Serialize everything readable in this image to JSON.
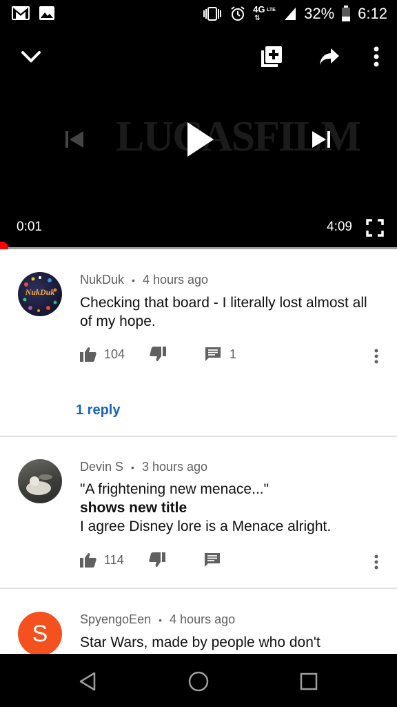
{
  "status_bar": {
    "network": "4G",
    "lte": "LTE",
    "battery": "32%",
    "time": "6:12"
  },
  "player": {
    "logo_text": "LUCASFILM",
    "current_time": "0:01",
    "duration": "4:09",
    "progress_fraction": 0.004,
    "icons": [
      "collapse-chevron-icon",
      "add-to-playlist-icon",
      "share-icon",
      "more-vert-icon",
      "skip-previous-icon",
      "play-icon",
      "skip-next-icon",
      "fullscreen-icon"
    ]
  },
  "comments": [
    {
      "author": "NukDuk",
      "age": "4 hours ago",
      "separator": "•",
      "text": "Checking that board - I literally lost almost all of my hope.",
      "likes": "104",
      "replies_count": "1",
      "reply_link": "1 reply",
      "avatar_text": "NukDuk",
      "avatar_color": "#1a1a2e"
    },
    {
      "author": "Devin S",
      "age": "3 hours ago",
      "separator": "•",
      "text_line1": "\"A frightening new menace...\"",
      "text_bold": "shows new title",
      "text_line3": "I agree Disney lore is a Menace alright.",
      "likes": "114",
      "avatar_color": "#5a5a55"
    },
    {
      "author": "SpyengoEen",
      "age": "4 hours ago",
      "separator": "•",
      "text": "Star Wars, made by people who don't",
      "avatar_letter": "S",
      "avatar_color": "#f4511e"
    }
  ],
  "colors": {
    "accent_red": "#ff0000",
    "link_blue": "#1565c0",
    "meta_gray": "#606060"
  }
}
